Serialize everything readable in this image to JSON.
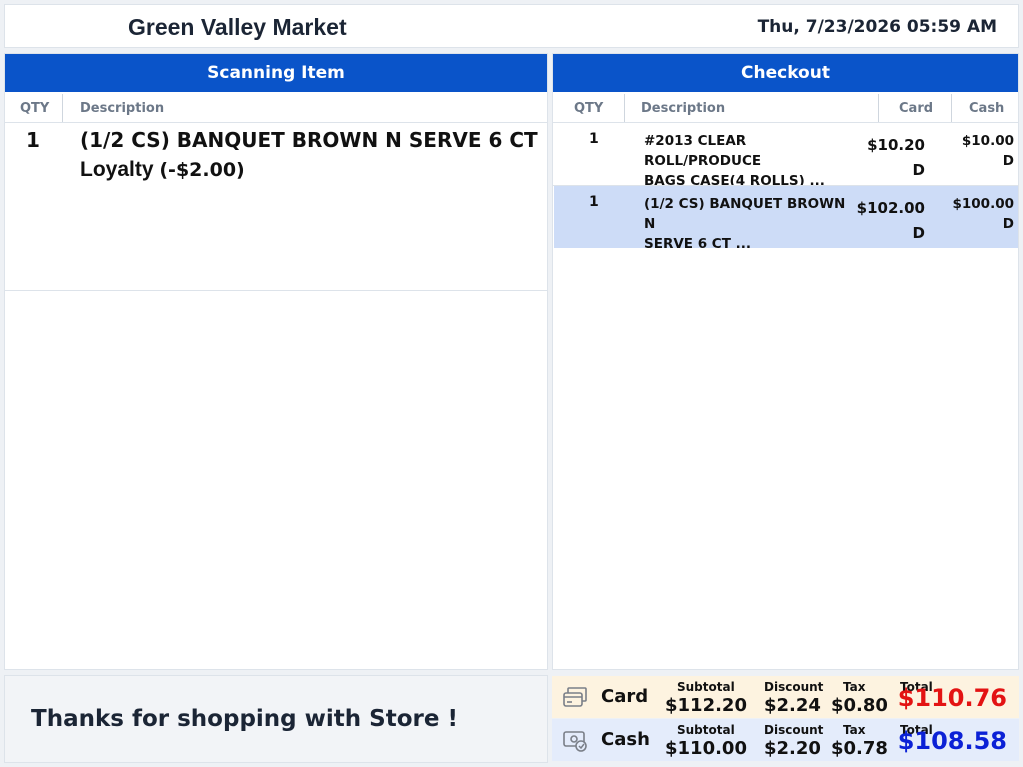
{
  "header": {
    "store_name": "Green Valley Market",
    "datetime": "Thu, 7/23/2026 05:59 AM"
  },
  "scanning": {
    "title": "Scanning Item",
    "col_qty": "QTY",
    "col_desc": "Description",
    "item": {
      "qty": "1",
      "description": "(1/2 CS) BANQUET BROWN N SERVE 6 CT",
      "loyalty_label": "Loyalty",
      "loyalty_amount": "(-$2.00)"
    }
  },
  "checkout": {
    "title": "Checkout",
    "col_qty": "QTY",
    "col_desc": "Description",
    "col_card": "Card",
    "col_cash": "Cash",
    "rows": [
      {
        "qty": "1",
        "desc1": "#2013 CLEAR ROLL/PRODUCE",
        "desc2": "BAGS CASE(4 ROLLS) ...",
        "card": "$10.20",
        "card_flag": "D",
        "cash": "$10.00",
        "cash_flag": "D",
        "selected": false
      },
      {
        "qty": "1",
        "desc1": "(1/2 CS) BANQUET BROWN N",
        "desc2": "SERVE 6 CT ...",
        "card": "$102.00",
        "card_flag": "D",
        "cash": "$100.00",
        "cash_flag": "D",
        "selected": true
      }
    ]
  },
  "footer": {
    "thanks": "Thanks for shopping with Store !"
  },
  "totals": {
    "subtotal_label": "Subtotal",
    "discount_label": "Discount",
    "tax_label": "Tax",
    "total_label": "Total",
    "card": {
      "label": "Card",
      "icon": "credit-card-icon",
      "subtotal": "$112.20",
      "discount": "$2.24",
      "tax": "$0.80",
      "total": "$110.76",
      "color": "#e31313"
    },
    "cash": {
      "label": "Cash",
      "icon": "cash-icon",
      "subtotal": "$110.00",
      "discount": "$2.20",
      "tax": "$0.78",
      "total": "$108.58",
      "color": "#0b21d6"
    }
  }
}
